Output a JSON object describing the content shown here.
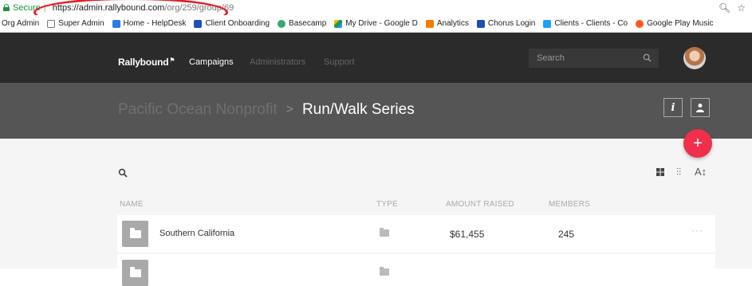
{
  "browser": {
    "secure_label": "Secure",
    "separator": "|",
    "url_host": "https://admin.rallybound.com",
    "url_path": "/org/259/group/69",
    "bookmarks": [
      {
        "label": "Org Admin",
        "color": "#e8e8e8"
      },
      {
        "label": "Super Admin",
        "color": "#e8e8e8"
      },
      {
        "label": "Home - HelpDesk",
        "color": "#2c7be5"
      },
      {
        "label": "Client Onboarding",
        "color": "#1e4fb5"
      },
      {
        "label": "Basecamp",
        "color": "#3aa76d"
      },
      {
        "label": "My Drive - Google D",
        "color": "#f4b400"
      },
      {
        "label": "Analytics",
        "color": "#f57c00"
      },
      {
        "label": "Chorus Login",
        "color": "#1e4fb5"
      },
      {
        "label": "Clients - Clients - Co",
        "color": "#1da1f2"
      },
      {
        "label": "Google Play Music",
        "color": "#ff5722"
      }
    ]
  },
  "nav": {
    "logo": "Rallybound",
    "items": [
      "Campaigns",
      "Administrators",
      "Support"
    ],
    "search_placeholder": "Search"
  },
  "header": {
    "breadcrumb_parent": "Pacific Ocean Nonprofit",
    "breadcrumb_sep": ">",
    "breadcrumb_current": "Run/Walk Series",
    "info_label": "i",
    "add_label": "+"
  },
  "table": {
    "columns": [
      "NAME",
      "TYPE",
      "AMOUNT RAISED",
      "MEMBERS"
    ],
    "rows": [
      {
        "name": "Southern California",
        "amount": "$61,455",
        "members": "245",
        "more": "···"
      }
    ]
  },
  "colors": {
    "nav_bg": "#2b2b2b",
    "header_bg": "#555555",
    "accent": "#f02f4c",
    "annotation": "#e81a22"
  }
}
